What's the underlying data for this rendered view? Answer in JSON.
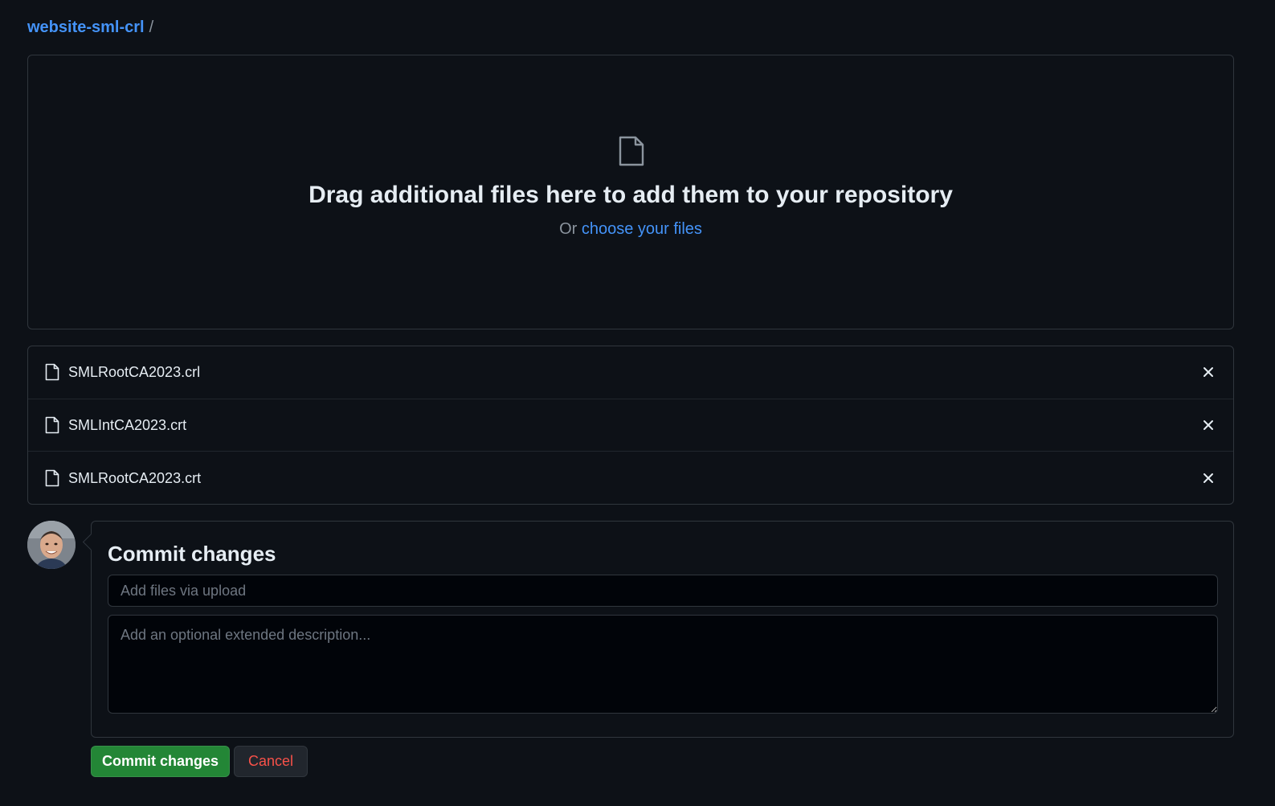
{
  "breadcrumb": {
    "repo": "website-sml-crl",
    "separator": "/"
  },
  "dropzone": {
    "icon": "file-icon",
    "title": "Drag additional files here to add them to your repository",
    "or_text": "Or",
    "choose_link": "choose your files"
  },
  "files": [
    {
      "name": "SMLRootCA2023.crl",
      "icon": "file-icon",
      "remove_icon": "close-icon"
    },
    {
      "name": "SMLIntCA2023.crt",
      "icon": "file-icon",
      "remove_icon": "close-icon"
    },
    {
      "name": "SMLRootCA2023.crt",
      "icon": "file-icon",
      "remove_icon": "close-icon"
    }
  ],
  "commit": {
    "title": "Commit changes",
    "summary_placeholder": "Add files via upload",
    "summary_value": "",
    "description_placeholder": "Add an optional extended description...",
    "description_value": "",
    "commit_button": "Commit changes",
    "cancel_button": "Cancel"
  },
  "colors": {
    "background": "#0d1117",
    "link": "#4493f8",
    "commit_button": "#238636",
    "cancel_text": "#f85149"
  }
}
